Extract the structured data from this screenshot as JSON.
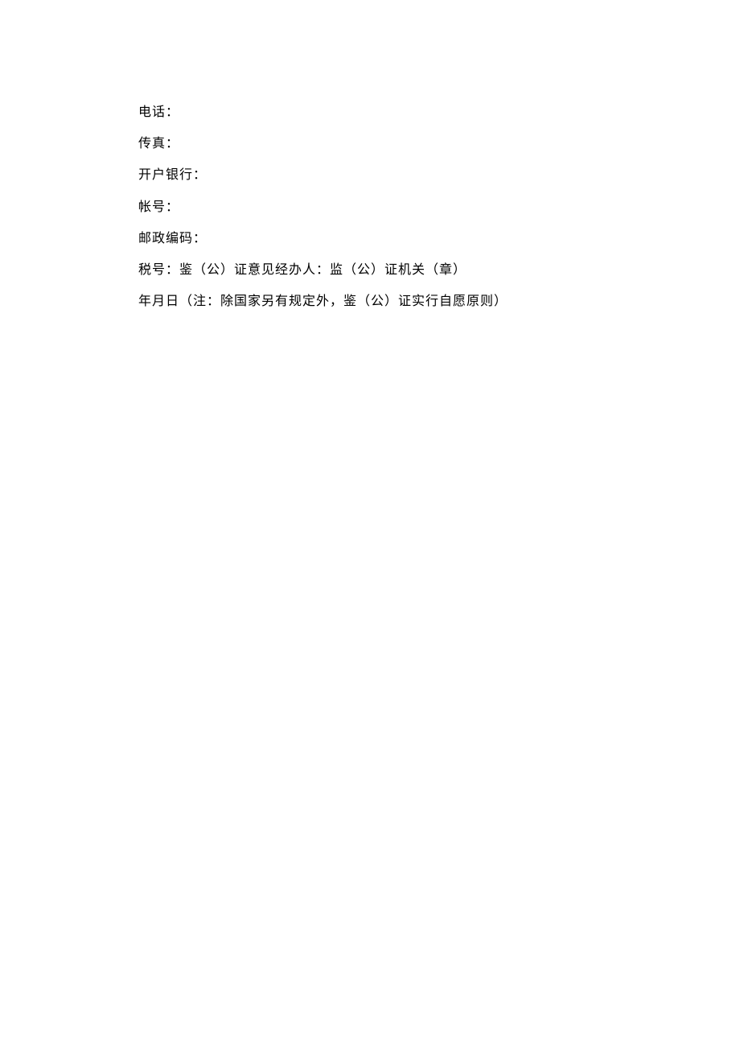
{
  "lines": [
    "电话：",
    "传真：",
    "开户银行：",
    "帐号：",
    "邮政编码：",
    "税号：鉴（公）证意见经办人：监（公）证机关（章）",
    "年月日（注：除国家另有规定外，鉴（公）证实行自愿原则）"
  ]
}
